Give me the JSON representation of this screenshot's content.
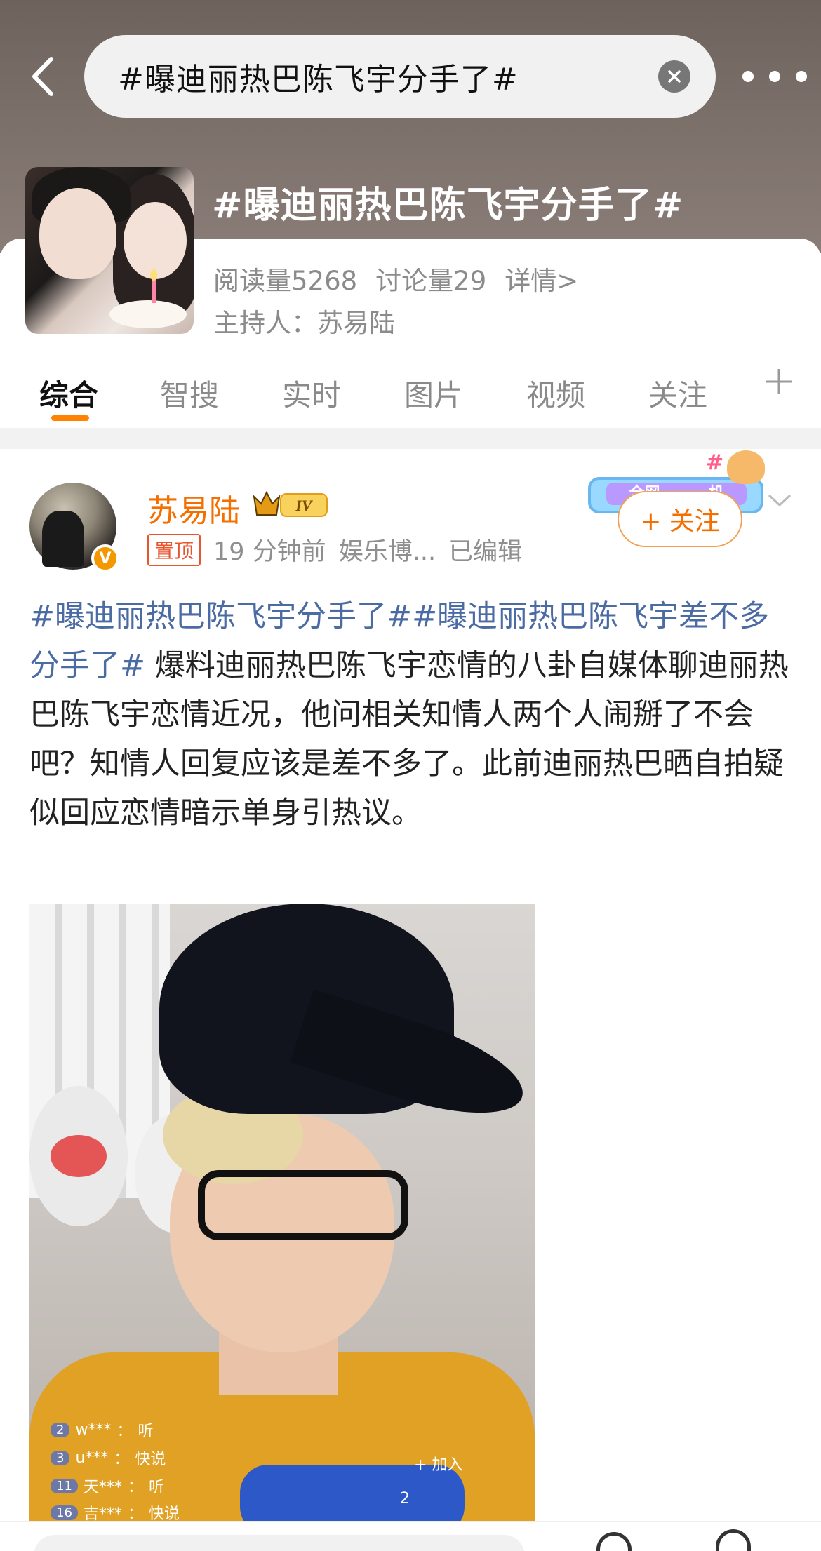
{
  "search": {
    "query": "#曝迪丽热巴陈飞宇分手了#"
  },
  "topic": {
    "title": "#曝迪丽热巴陈飞宇分手了#",
    "reads": "阅读量5268",
    "discussions": "讨论量29",
    "details": "详情>",
    "host": "主持人：苏易陆"
  },
  "tabs": [
    {
      "label": "综合",
      "active": true
    },
    {
      "label": "智搜"
    },
    {
      "label": "实时"
    },
    {
      "label": "图片"
    },
    {
      "label": "视频"
    },
    {
      "label": "关注"
    }
  ],
  "post": {
    "author": "苏易陆",
    "level_badge": "IV",
    "verified_badge": "V",
    "pinned": "置顶",
    "time": "19 分钟前",
    "source": "娱乐博...",
    "edited": "已编辑",
    "follow_label": "+ 关注",
    "promo_text": "全网",
    "promo_text_right": "机",
    "topic1": "#曝迪丽热巴陈飞宇分手了#",
    "topic2": "#曝迪丽热巴陈飞宇差不多分手了#",
    "body": " 爆料迪丽热巴陈飞宇恋情的八卦自媒体聊迪丽热巴陈飞宇恋情近况，他问相关知情人两个人闹掰了不会吧？知情人回复应该是差不多了。此前迪丽热巴晒自拍疑似回应恋情暗示单身引热议。"
  },
  "live_overlay": {
    "comments": [
      {
        "level": "2",
        "user": "w***",
        "text": "听"
      },
      {
        "level": "3",
        "user": "u***",
        "text": "快说"
      },
      {
        "level": "11",
        "user": "天***",
        "text": "听"
      },
      {
        "level": "16",
        "user": "吉***",
        "text": "快说"
      }
    ],
    "join_label": "+ 加入",
    "viewer_count": "2"
  },
  "colors": {
    "accent": "#ff8200",
    "author": "#f56f00",
    "topic_link": "#4b6ba3",
    "pin": "#e8542e"
  }
}
